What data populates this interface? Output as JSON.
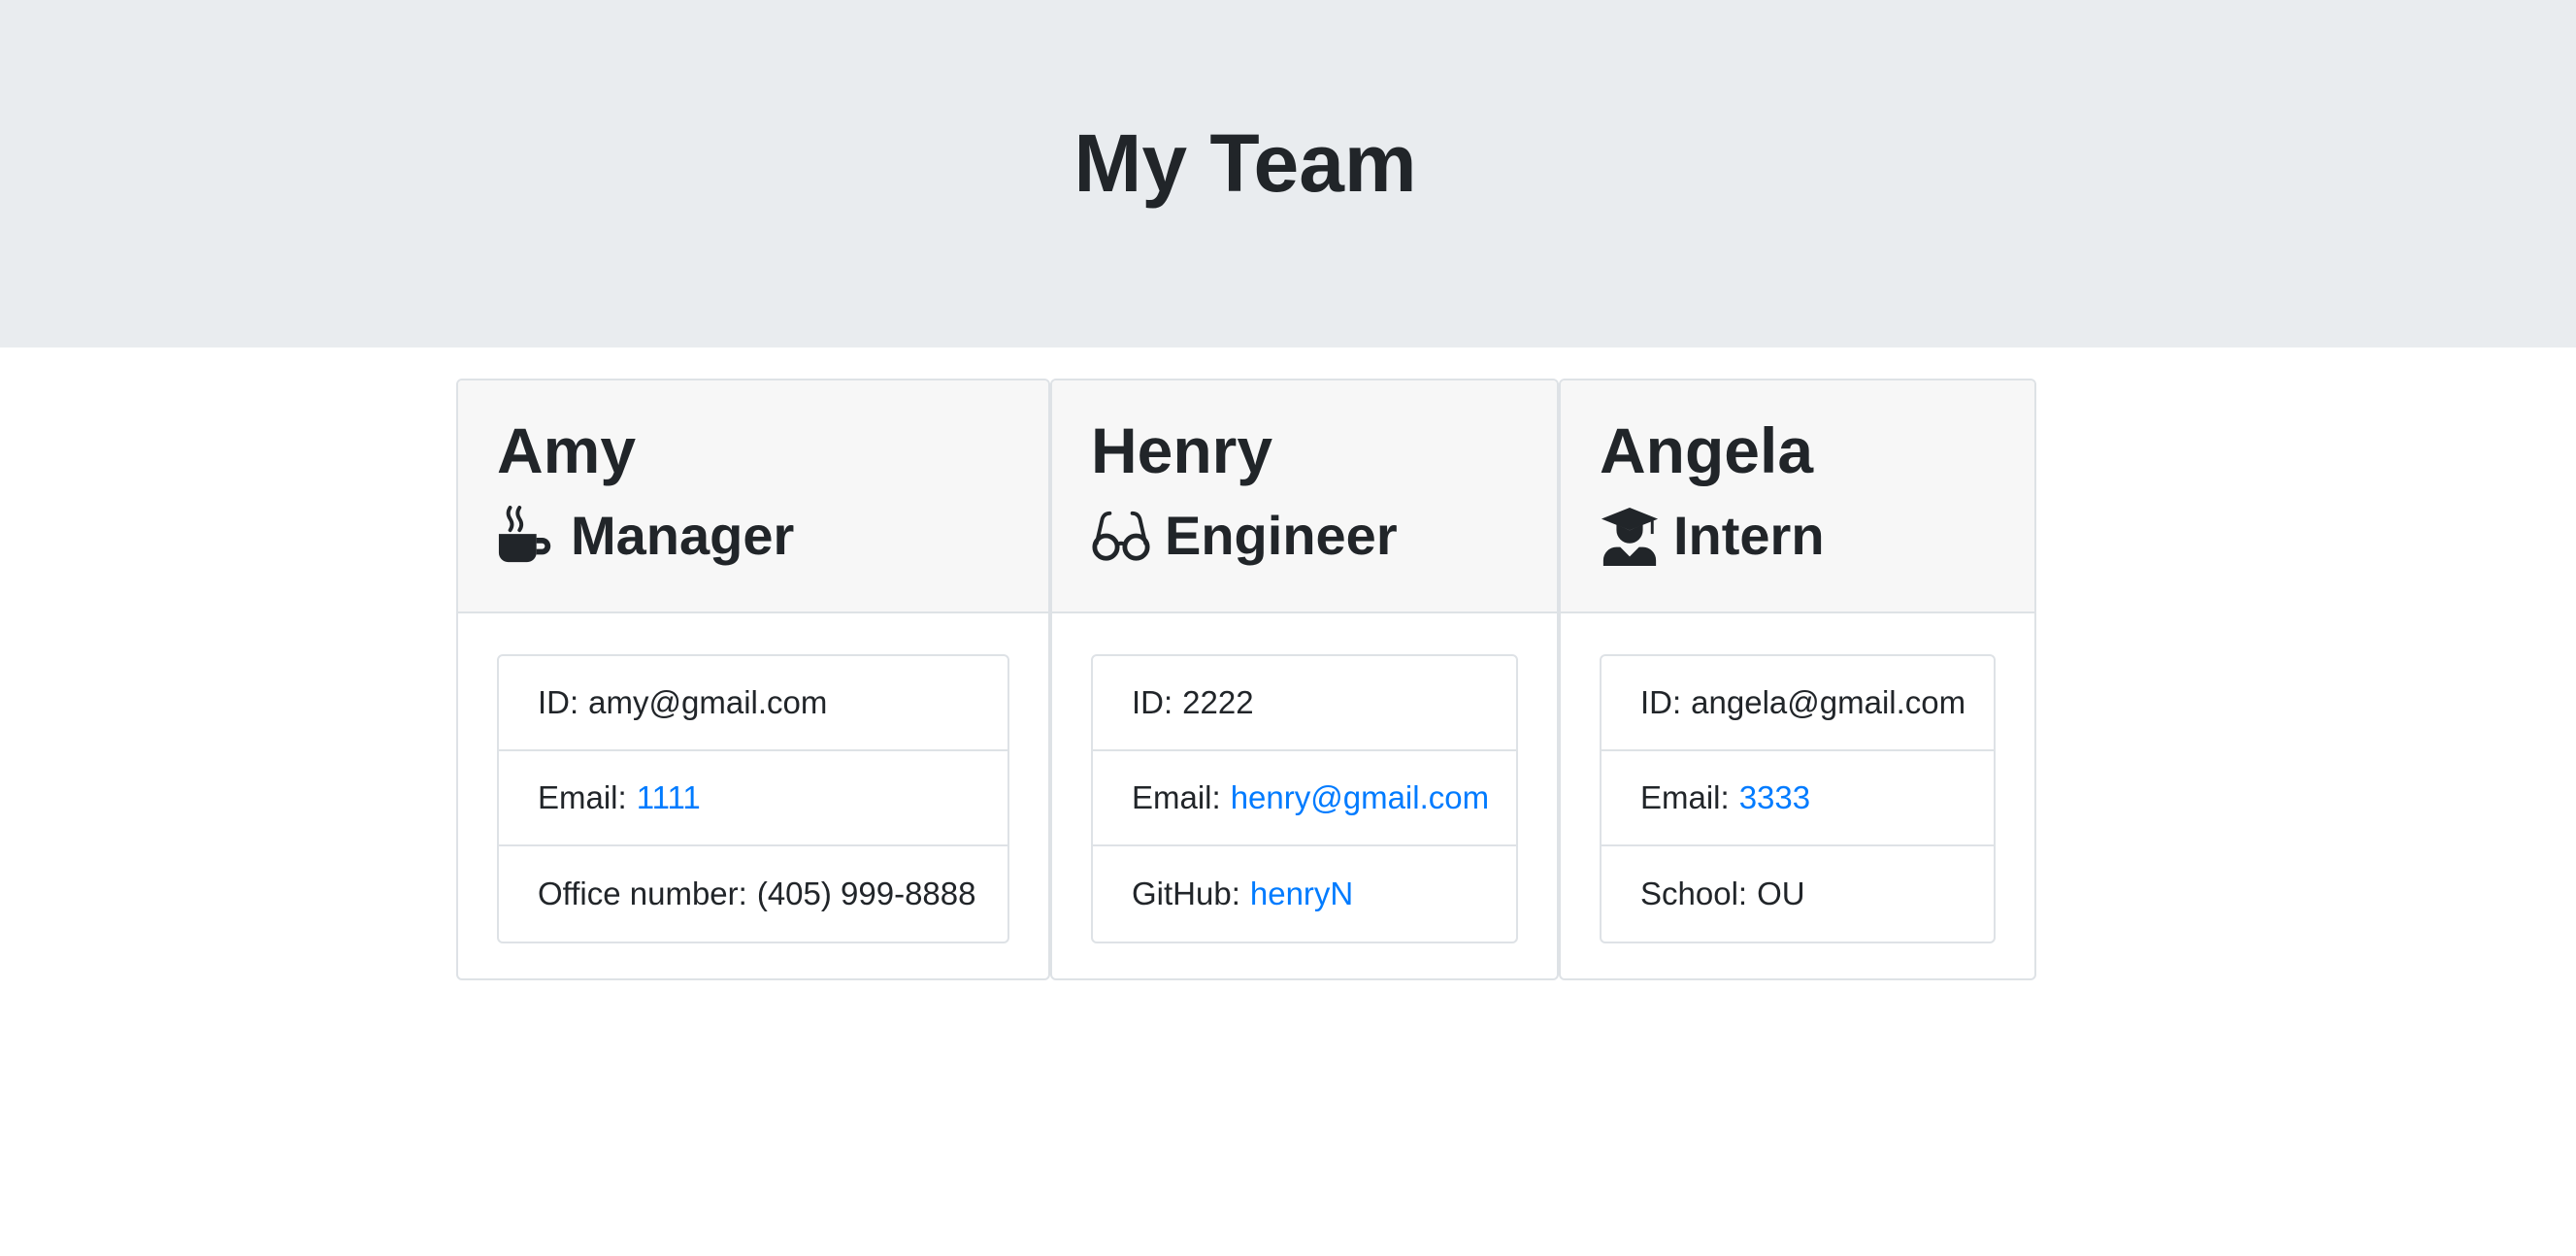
{
  "header": {
    "title": "My Team"
  },
  "colors": {
    "jumbotron_bg": "#e9ecef",
    "link": "#007bff",
    "text": "#212529"
  },
  "cards": [
    {
      "name": "Amy",
      "role": "Manager",
      "icon": "mug-hot-icon",
      "id_label": "ID:",
      "id_value": "amy@gmail.com",
      "email_label": "Email:",
      "email_value": "1111",
      "extra_label": "Office number:",
      "extra_value": "(405) 999-8888"
    },
    {
      "name": "Henry",
      "role": "Engineer",
      "icon": "glasses-icon",
      "id_label": "ID:",
      "id_value": "2222",
      "email_label": "Email:",
      "email_value": "henry@gmail.com",
      "extra_label": "GitHub:",
      "extra_value": "henryN"
    },
    {
      "name": "Angela",
      "role": "Intern",
      "icon": "graduate-icon",
      "id_label": "ID:",
      "id_value": "angela@gmail.com",
      "email_label": "Email:",
      "email_value": "3333",
      "extra_label": "School:",
      "extra_value": "OU"
    }
  ]
}
